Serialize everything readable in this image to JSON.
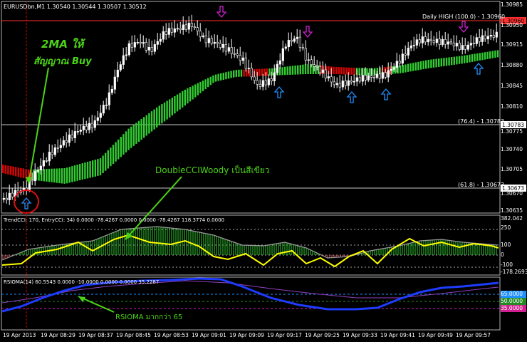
{
  "chart_header": {
    "symbol": "EURUSDbn,M1",
    "ohlc": "1.30540 1.30544 1.30507 1.30512"
  },
  "main_price_scale": [
    "1.30985",
    "1.30950",
    "1.30915",
    "1.30880",
    "1.30845",
    "1.30810",
    "1.30775",
    "1.30740",
    "1.30705",
    "1.30670",
    "1.30635"
  ],
  "level_labels": {
    "daily_high": "Daily HIGH (100.0) - 1.30960",
    "fib_764": "(76.4) - 1.30783",
    "fib_618": "(61.8) - 1.30673"
  },
  "price_boxes": {
    "high": "1.30960",
    "fib_764": "1.30783",
    "fib_618": "1.30673"
  },
  "cci_panel": {
    "header": "TrendCCI: 170, EntryCCI: 34)  0.0000  -78.4267  0.0000  0.0000  -78.4267  118.3774  0.0000",
    "scale": [
      "382.042",
      "250",
      "100",
      "0",
      "-100",
      "-178.2693"
    ]
  },
  "rsioma_panel": {
    "header": "RSIOMA(14) 60.5543  0.0000  -10.0000  0.0000  0.0000  35.2287",
    "scale": [
      "65.0000",
      "50.0000",
      "35.0000"
    ],
    "colors": {
      "level65": "#1e90ff",
      "level50": "#228b22",
      "level35": "#d02090"
    }
  },
  "time_axis": [
    "19 Apr 2013",
    "19 Apr 08:29",
    "19 Apr 08:37",
    "19 Apr 08:45",
    "19 Apr 08:53",
    "19 Apr 09:01",
    "19 Apr 09:09",
    "19 Apr 09:17",
    "19 Apr 09:25",
    "19 Apr 09:33",
    "19 Apr 09:41",
    "19 Apr 09:49",
    "19 Apr 09:57"
  ],
  "annotations": {
    "ma_title": "2MA ให้",
    "ma_subtitle": "สัญญาณ Buy",
    "cci_note": "DoubleCCIWoody เป็นสีเขียว",
    "rsioma_note": "RSIOMA มากกว่า 65"
  },
  "colors": {
    "background": "#000000",
    "bull_band": "#32cd32",
    "bear_band": "#e00000",
    "annotation_green": "#4cd417",
    "arrow_up": "#1e90ff",
    "arrow_down": "#d020d0",
    "cci_line": "#ffff00",
    "rsioma_line": "#1e3cff"
  }
}
